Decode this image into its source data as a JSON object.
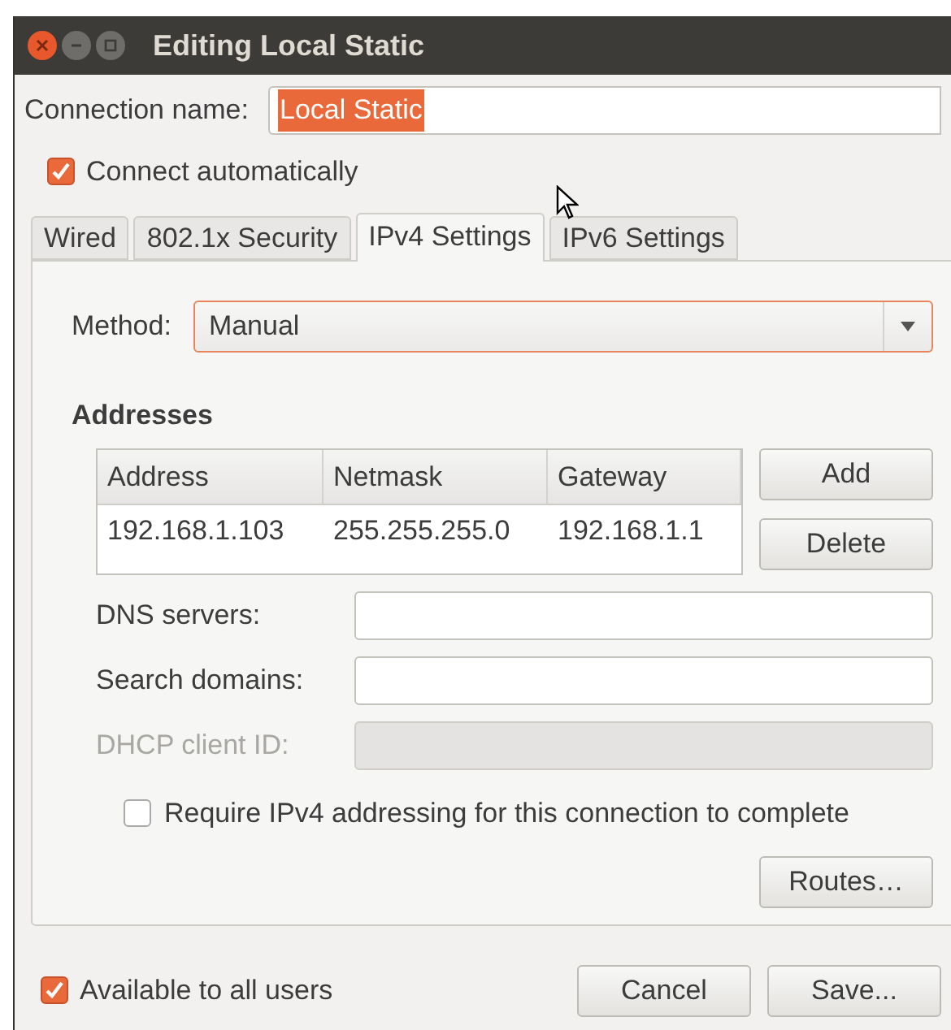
{
  "window": {
    "title": "Editing Local Static"
  },
  "connection_name": {
    "label": "Connection name:",
    "value": "Local Static"
  },
  "connect_automatically": {
    "label": "Connect automatically",
    "checked": true
  },
  "tabs": [
    {
      "label": "Wired",
      "selected": false
    },
    {
      "label": "802.1x Security",
      "selected": false
    },
    {
      "label": "IPv4 Settings",
      "selected": true
    },
    {
      "label": "IPv6 Settings",
      "selected": false
    }
  ],
  "method": {
    "label": "Method:",
    "value": "Manual"
  },
  "addresses": {
    "heading": "Addresses",
    "columns": [
      "Address",
      "Netmask",
      "Gateway"
    ],
    "rows": [
      [
        "192.168.1.103",
        "255.255.255.0",
        "192.168.1.1"
      ]
    ],
    "buttons": [
      "Add",
      "Delete"
    ]
  },
  "fields": [
    {
      "label": "DNS servers:",
      "disabled": false
    },
    {
      "label": "Search domains:",
      "disabled": false
    },
    {
      "label": "DHCP client ID:",
      "disabled": true
    }
  ],
  "require_ipv4": {
    "label": "Require IPv4 addressing for this connection to complete",
    "checked": false
  },
  "routes_button": "Routes…",
  "available_to_all_users": {
    "label": "Available to all users",
    "checked": true
  },
  "buttons": [
    "Cancel",
    "Save..."
  ]
}
